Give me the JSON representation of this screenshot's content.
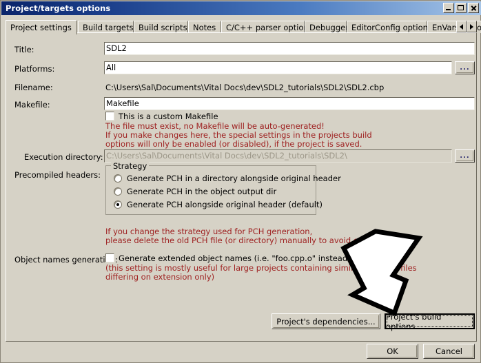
{
  "window": {
    "title": "Project/targets options",
    "minimize_label": "Minimize",
    "maximize_label": "Maximize",
    "close_label": "Close"
  },
  "tabs": [
    {
      "label": "Project settings",
      "active": true
    },
    {
      "label": "Build targets",
      "active": false
    },
    {
      "label": "Build scripts",
      "active": false
    },
    {
      "label": "Notes",
      "active": false
    },
    {
      "label": "C/C++ parser options",
      "active": false
    },
    {
      "label": "Debugger",
      "active": false
    },
    {
      "label": "EditorConfig options",
      "active": false
    },
    {
      "label": "EnVars options",
      "active": false
    }
  ],
  "tab_scroll": {
    "left": "◄",
    "right": "►"
  },
  "fields": {
    "title_label": "Title:",
    "title_value": "SDL2",
    "platforms_label": "Platforms:",
    "platforms_value": "All",
    "platforms_browse": "...",
    "filename_label": "Filename:",
    "filename_value": "C:\\Users\\Sal\\Documents\\Vital Docs\\dev\\SDL2_tutorials\\SDL2\\SDL2.cbp",
    "makefile_label": "Makefile:",
    "makefile_value": "Makefile",
    "custom_makefile_label": "This is a custom Makefile",
    "custom_makefile_checked": false,
    "exec_dir_label": "Execution directory:",
    "exec_dir_value": "C:\\Users\\Sal\\Documents\\Vital Docs\\dev\\SDL2_tutorials\\SDL2\\",
    "exec_dir_browse": "...",
    "exec_dir_disabled": true
  },
  "makefile_warning": [
    "The file must exist, no Makefile will be auto-generated!",
    "If you make changes here, the special settings in the projects build",
    "options will only be enabled (or disabled), if the project is saved."
  ],
  "precompiled": {
    "label": "Precompiled headers:",
    "group_legend": "Strategy",
    "options": [
      {
        "label": "Generate PCH in a directory alongside original header",
        "selected": false
      },
      {
        "label": "Generate PCH in the object output dir",
        "selected": false
      },
      {
        "label": "Generate PCH alongside original header (default)",
        "selected": true
      }
    ],
    "warning": [
      "If you change the strategy used for PCH generation,",
      "please delete the old PCH file (or directory) manually to avoid conflicts..."
    ]
  },
  "object_names": {
    "label": "Object names generation:",
    "checkbox_label": "Generate extended object names (i.e. \"foo.cpp.o\" instead of \"foo.o\")",
    "checked": false,
    "note": [
      "(this setting is mostly useful for large projects containing similarly named files",
      "differing on extension only)"
    ]
  },
  "buttons": {
    "dependencies": "Project's dependencies...",
    "build_options": "Project's build options...",
    "ok": "OK",
    "cancel": "Cancel"
  },
  "annotation": {
    "arrow_name": "arrow-pointing-to-build-options",
    "fill": "#ffffff",
    "stroke": "#000000"
  },
  "colors": {
    "dialog_face": "#d6d2c6",
    "title_start": "#0a246a",
    "title_end": "#a7c6e8",
    "warning_text": "#9e2020",
    "field_bg": "#ffffff",
    "disabled_text": "#9b9687"
  }
}
